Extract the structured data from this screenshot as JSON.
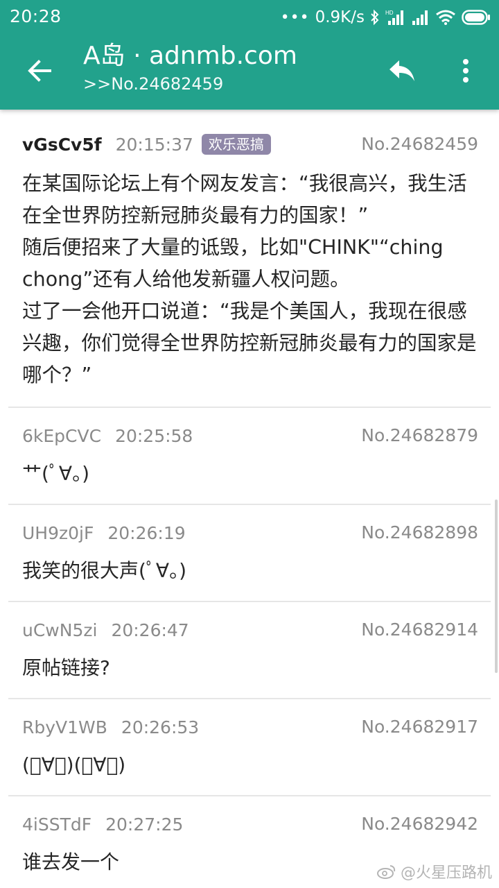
{
  "status_bar": {
    "time": "20:28",
    "network_speed": "0.9K/s"
  },
  "app_bar": {
    "title": "A岛 · adnmb.com",
    "subtitle": ">>No.24682459"
  },
  "op": {
    "uid": "vGsCv5f",
    "time": "20:15:37",
    "tag": "欢乐恶搞",
    "no": "No.24682459",
    "lines": [
      "在某国际论坛上有个网友发言：“我很高兴，我生活在全世界防控新冠肺炎最有力的国家！”",
      "随后便招来了大量的诋毁，比如\"CHINK\"“ching chong”还有人给他发新疆人权问题。",
      "过了一会他开口说道：“我是个美国人，我现在很感兴趣，你们觉得全世界防控新冠肺炎最有力的国家是哪个？”"
    ]
  },
  "replies": [
    {
      "uid": "6kEpCVC",
      "time": "20:25:58",
      "no": "No.24682879",
      "content": "艹(ﾟ∀。)"
    },
    {
      "uid": "UH9z0jF",
      "time": "20:26:19",
      "no": "No.24682898",
      "content": "我笑的很大声(ﾟ∀。)"
    },
    {
      "uid": "uCwN5zi",
      "time": "20:26:47",
      "no": "No.24682914",
      "content": "原帖链接?"
    },
    {
      "uid": "RbyV1WB",
      "time": "20:26:53",
      "no": "No.24682917",
      "content": "(ﾟ∀。)(ﾟ∀。)"
    },
    {
      "uid": "4iSSTdF",
      "time": "20:27:25",
      "no": "No.24682942",
      "content": "谁去发一个"
    }
  ],
  "watermark": "@火星压路机",
  "colors": {
    "header": "#22a28c",
    "tag_bg": "#8f87a8",
    "meta_text": "#8a8a8a"
  },
  "icons": {
    "back": "arrow-back-icon",
    "reply": "reply-icon",
    "more": "more-vert-icon"
  }
}
